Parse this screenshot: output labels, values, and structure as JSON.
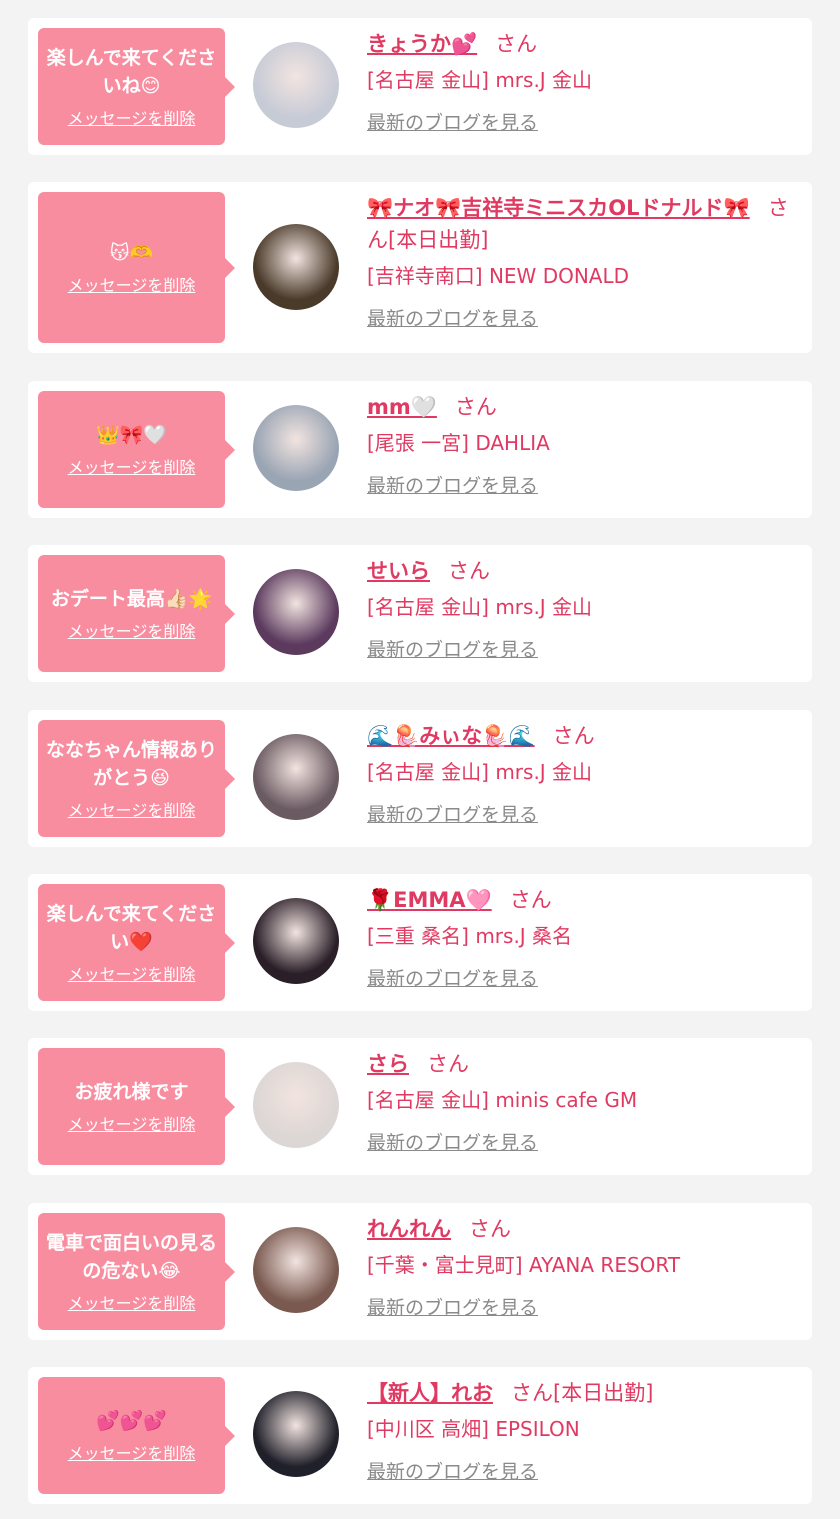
{
  "delete_label": "メッセージを削除",
  "blog_label": "最新のブログを見る",
  "colors": {
    "bubble": "#f98da0",
    "accent": "#e03a62",
    "background": "#f3f3f3",
    "link_gray": "#8a8a8a"
  },
  "items": [
    {
      "message": "楽しんで来てくださいね😊",
      "name": "きょうか💕",
      "suffix": "さん",
      "shop": "[名古屋 金山] mrs.J 金山",
      "avatar_color": "#c7cbd6"
    },
    {
      "message": "😽🫶",
      "name": "🎀ナオ🎀吉祥寺ミニスカOLドナルド🎀",
      "suffix": "さん[本日出勤]",
      "shop": "[吉祥寺南口] NEW DONALD",
      "avatar_color": "#4a3a2a"
    },
    {
      "message": "👑🎀🤍",
      "name": "mm🤍",
      "suffix": "さん",
      "shop": "[尾張 一宮] DAHLIA",
      "avatar_color": "#9aa5b4"
    },
    {
      "message": "おデート最高👍🏻🌟",
      "name": "せいら",
      "suffix": "さん",
      "shop": "[名古屋 金山] mrs.J 金山",
      "avatar_color": "#5b3a5e"
    },
    {
      "message": "ななちゃん情報ありがとう😆",
      "name": "🌊🪼みぃな🪼🌊",
      "suffix": "さん",
      "shop": "[名古屋 金山] mrs.J 金山",
      "avatar_color": "#6a5a62"
    },
    {
      "message": "楽しんで来てください❤️",
      "name": "🌹EMMA🩷",
      "suffix": "さん",
      "shop": "[三重 桑名] mrs.J 桑名",
      "avatar_color": "#2a1e28"
    },
    {
      "message": "お疲れ様です",
      "name": "さら",
      "suffix": "さん",
      "shop": "[名古屋 金山] minis cafe GM",
      "avatar_color": "#dcd6d4"
    },
    {
      "message": "電車で面白いの見るの危ない😂",
      "name": "れんれん",
      "suffix": "さん",
      "shop": "[千葉・富士見町] AYANA RESORT",
      "avatar_color": "#7a5a50"
    },
    {
      "message": "💕💕💕",
      "name": "【新人】れお",
      "suffix": "さん[本日出勤]",
      "shop": "[中川区 高畑] EPSILON",
      "avatar_color": "#20202a"
    }
  ]
}
